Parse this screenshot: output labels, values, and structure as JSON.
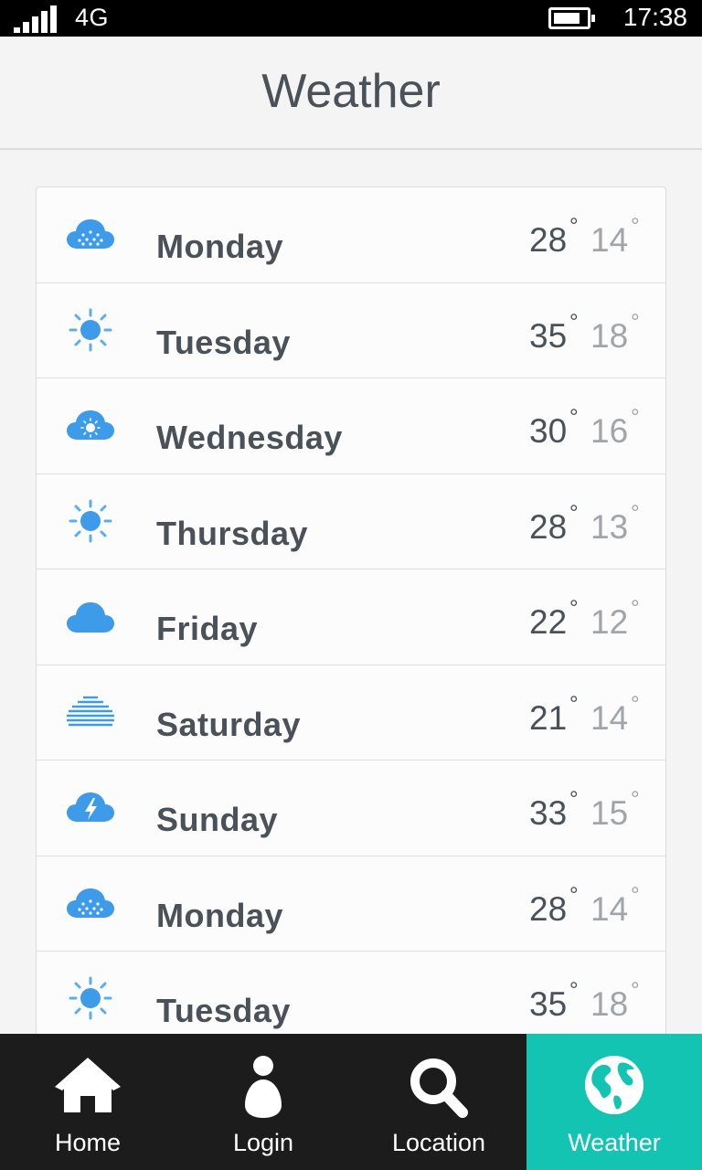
{
  "status_bar": {
    "network": "4G",
    "time": "17:38",
    "signal_bars": 5,
    "battery_level": 0.65
  },
  "header": {
    "title": "Weather"
  },
  "forecast": [
    {
      "day": "Monday",
      "high": "28",
      "low": "14",
      "icon": "rain-cloud-icon"
    },
    {
      "day": "Tuesday",
      "high": "35",
      "low": "18",
      "icon": "sun-icon"
    },
    {
      "day": "Wednesday",
      "high": "30",
      "low": "16",
      "icon": "sun-cloud-icon"
    },
    {
      "day": "Thursday",
      "high": "28",
      "low": "13",
      "icon": "sun-icon"
    },
    {
      "day": "Friday",
      "high": "22",
      "low": "12",
      "icon": "cloud-icon"
    },
    {
      "day": "Saturday",
      "high": "21",
      "low": "14",
      "icon": "fog-icon"
    },
    {
      "day": "Sunday",
      "high": "33",
      "low": "15",
      "icon": "thunder-cloud-icon"
    },
    {
      "day": "Monday",
      "high": "28",
      "low": "14",
      "icon": "rain-cloud-icon"
    },
    {
      "day": "Tuesday",
      "high": "35",
      "low": "18",
      "icon": "sun-icon"
    }
  ],
  "degree_symbol": "°",
  "tabs": [
    {
      "label": "Home",
      "icon": "home-icon",
      "active": false
    },
    {
      "label": "Login",
      "icon": "user-icon",
      "active": false
    },
    {
      "label": "Location",
      "icon": "search-icon",
      "active": false
    },
    {
      "label": "Weather",
      "icon": "globe-icon",
      "active": true
    }
  ],
  "colors": {
    "accent": "#12c4b1",
    "icon_blue": "#3d9be9",
    "text_dark": "#4a5158",
    "text_light": "#a0a5aa",
    "tabbar_bg": "#1c1c1c"
  }
}
